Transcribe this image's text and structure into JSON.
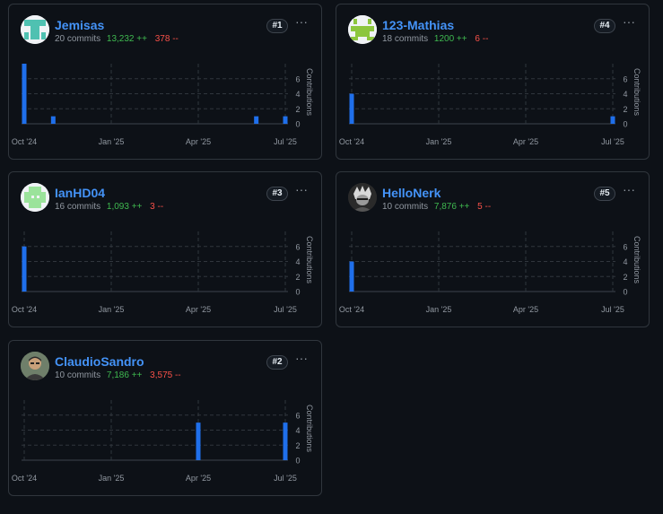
{
  "contributors": [
    {
      "name": "Jemisas",
      "rank": "#1",
      "commits": "20 commits",
      "additions": "13,232 ++",
      "deletions": "378 --",
      "avatar_icon": "identicon-teal",
      "chart_data": {
        "type": "bar",
        "title": "",
        "xlabel": "",
        "ylabel": "Contributions",
        "ylim": [
          0,
          8
        ],
        "yticks": [
          "0",
          "2",
          "4",
          "6"
        ],
        "grid": true,
        "xticks": [
          "Oct '24",
          "Jan '25",
          "Apr '25",
          "Jul '25"
        ],
        "x": [
          "Oct '24",
          "Nov '24",
          "Jun '25",
          "Jul '25"
        ],
        "values": [
          8,
          1,
          1,
          1
        ]
      }
    },
    {
      "name": "123-Mathias",
      "rank": "#4",
      "commits": "18 commits",
      "additions": "1200 ++",
      "deletions": "6 --",
      "avatar_icon": "identicon-green",
      "chart_data": {
        "type": "bar",
        "title": "",
        "xlabel": "",
        "ylabel": "Contributions",
        "ylim": [
          0,
          8
        ],
        "yticks": [
          "0",
          "2",
          "4",
          "6"
        ],
        "grid": true,
        "xticks": [
          "Oct '24",
          "Jan '25",
          "Apr '25",
          "Jul '25"
        ],
        "x": [
          "Oct '24",
          "Jul '25"
        ],
        "values": [
          4,
          1
        ]
      }
    },
    {
      "name": "IanHD04",
      "rank": "#3",
      "commits": "16 commits",
      "additions": "1,093 ++",
      "deletions": "3 --",
      "avatar_icon": "identicon-lightgreen",
      "chart_data": {
        "type": "bar",
        "title": "",
        "xlabel": "",
        "ylabel": "Contributions",
        "ylim": [
          0,
          8
        ],
        "yticks": [
          "0",
          "2",
          "4",
          "6"
        ],
        "grid": true,
        "xticks": [
          "Oct '24",
          "Jan '25",
          "Apr '25",
          "Jul '25"
        ],
        "x": [
          "Oct '24"
        ],
        "values": [
          6
        ]
      }
    },
    {
      "name": "HelloNerk",
      "rank": "#5",
      "commits": "10 commits",
      "additions": "7,876 ++",
      "deletions": "5 --",
      "avatar_icon": "photo-avatar-dark",
      "chart_data": {
        "type": "bar",
        "title": "",
        "xlabel": "",
        "ylabel": "Contributions",
        "ylim": [
          0,
          8
        ],
        "yticks": [
          "0",
          "2",
          "4",
          "6"
        ],
        "grid": true,
        "xticks": [
          "Oct '24",
          "Jan '25",
          "Apr '25",
          "Jul '25"
        ],
        "x": [
          "Oct '24"
        ],
        "values": [
          4
        ]
      }
    },
    {
      "name": "ClaudioSandro",
      "rank": "#2",
      "commits": "10 commits",
      "additions": "7,186 ++",
      "deletions": "3,575 --",
      "avatar_icon": "photo-avatar-person",
      "chart_data": {
        "type": "bar",
        "title": "",
        "xlabel": "",
        "ylabel": "Contributions",
        "ylim": [
          0,
          8
        ],
        "yticks": [
          "0",
          "2",
          "4",
          "6"
        ],
        "grid": true,
        "xticks": [
          "Oct '24",
          "Jan '25",
          "Apr '25",
          "Jul '25"
        ],
        "x": [
          "Apr '25",
          "Jul '25"
        ],
        "values": [
          5,
          5
        ]
      }
    }
  ],
  "colors": {
    "bar": "#1f6feb",
    "link": "#4493f8",
    "additions": "#3fb950",
    "deletions": "#f85149",
    "border": "#30363d",
    "grid": "#30363d",
    "axis_text": "#9198a1"
  },
  "ui": {
    "more_label": "···"
  }
}
